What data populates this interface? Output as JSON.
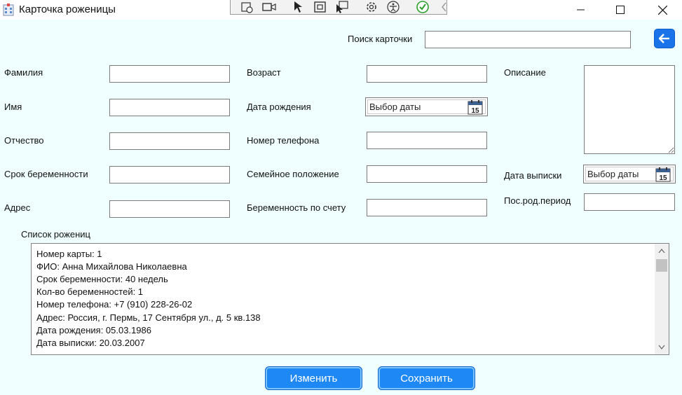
{
  "window": {
    "title": "Карточка роженицы",
    "icon": "app-building-icon",
    "controls": [
      "minimize-icon",
      "maximize-icon",
      "close-icon"
    ]
  },
  "debug_toolbar": {
    "icons": [
      "select-element-icon",
      "video-icon",
      "pointer-icon",
      "frame-icon",
      "pointer-select-icon",
      "gear-icon",
      "accessibility-icon",
      "check-icon",
      "chevron-left-icon"
    ]
  },
  "search": {
    "label": "Поиск карточки",
    "value": ""
  },
  "back_button": {
    "icon": "arrow-left-icon"
  },
  "form": {
    "surname_label": "Фамилия",
    "name_label": "Имя",
    "patronymic_label": "Отчество",
    "pregnancy_term_label": "Срок беременности",
    "address_label": "Адрес",
    "age_label": "Возраст",
    "birth_date_label": "Дата рождения",
    "birth_date_placeholder": "Выбор даты",
    "phone_label": "Номер телефона",
    "marital_status_label": "Семейное положение",
    "pregnancy_count_label": "Беременность по счету",
    "description_label": "Описание",
    "discharge_date_label": "Дата выписки",
    "discharge_date_placeholder": "Выбор даты",
    "postnatal_label": "Пос.род.период",
    "calendar_day": "15"
  },
  "list": {
    "label": "Список рожениц",
    "lines": [
      "Номер карты: 1",
      "ФИО: Анна Михайлова Николаевна",
      "Срок беременности: 40  недель",
      "Кол-во беременностей: 1",
      "Номер телефона: +7 (910) 228-26-02",
      "Адрес: Россия, г. Пермь, 17 Сентября ул., д. 5 кв.138",
      "Дата рождения: 05.03.1986",
      "Дата выписки: 20.03.2007"
    ]
  },
  "buttons": {
    "edit": "Изменить",
    "save": "Сохранить"
  },
  "colors": {
    "background": "#f0ffff",
    "accent": "#1e88f5"
  }
}
